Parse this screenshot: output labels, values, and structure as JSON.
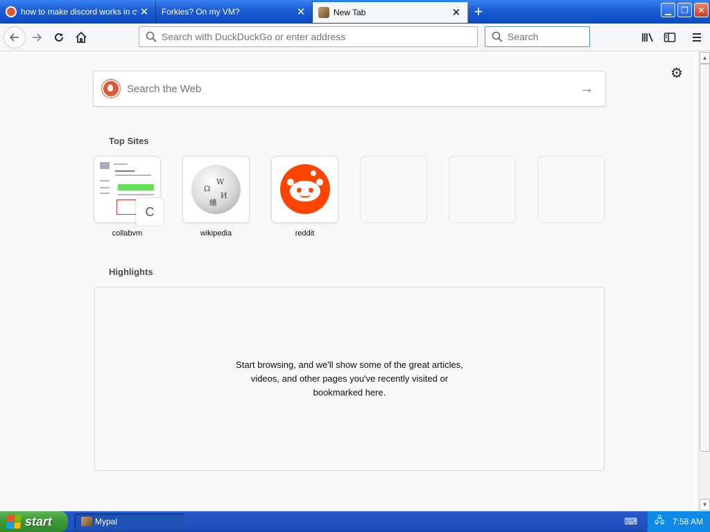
{
  "tabs": [
    {
      "label": "how to make discord works in cvm",
      "favicon": "duckduckgo-icon",
      "active": false
    },
    {
      "label": "Forkies? On my VM?",
      "favicon": "none",
      "active": false
    },
    {
      "label": "New Tab",
      "favicon": "mypal-bird-icon",
      "active": true
    }
  ],
  "toolbar": {
    "url_placeholder": "Search with DuckDuckGo or enter address",
    "search_placeholder": "Search"
  },
  "newtab": {
    "web_search_placeholder": "Search the Web",
    "top_sites_title": "Top Sites",
    "top_sites": [
      {
        "label": "collabvm",
        "badge_letter": "C"
      },
      {
        "label": "wikipedia"
      },
      {
        "label": "reddit"
      },
      {
        "label": ""
      },
      {
        "label": ""
      },
      {
        "label": ""
      }
    ],
    "highlights_title": "Highlights",
    "highlights_empty_message": "Start browsing, and we'll show some of the great articles, videos, and other pages you've recently visited or bookmarked here."
  },
  "taskbar": {
    "start_label": "start",
    "task_label": "Mypal",
    "clock": "7:58 AM"
  },
  "colors": {
    "accent": "#0a84ff",
    "ddg_orange": "#de5833",
    "reddit_orange": "#ff4500",
    "xp_blue": "#245edb",
    "xp_green": "#3d9a39"
  }
}
